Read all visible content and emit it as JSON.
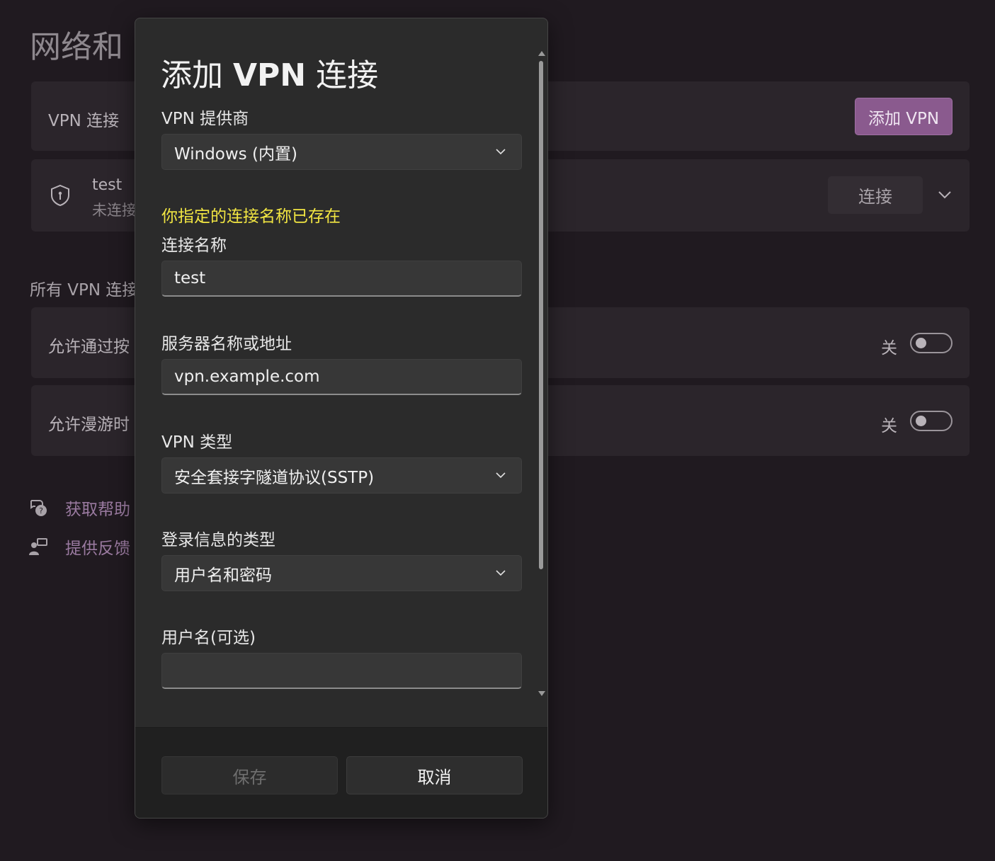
{
  "background": {
    "page_title": "网络和",
    "vpn_card": {
      "label": "VPN 连接",
      "add_button": "添加 VPN"
    },
    "test_card": {
      "name": "test",
      "status": "未连接",
      "connect_button": "连接"
    },
    "section_heading": "所有 VPN 连接",
    "allow_metered": {
      "label": "允许通过按",
      "state": "关"
    },
    "allow_roaming": {
      "label": "允许漫游时",
      "state": "关"
    },
    "links": {
      "help": "获取帮助",
      "feedback": "提供反馈"
    },
    "accent_color": "#8a5a8e"
  },
  "dialog": {
    "title_prefix": "添加 ",
    "title_bold": "VPN",
    "title_suffix": " 连接",
    "provider_label": "VPN 提供商",
    "provider_value": "Windows (内置)",
    "warning": "你指定的连接名称已存在",
    "name_label": "连接名称",
    "name_value": "test",
    "server_label": "服务器名称或地址",
    "server_value": "vpn.example.com",
    "type_label": "VPN 类型",
    "type_value": "安全套接字隧道协议(SSTP)",
    "signin_label": "登录信息的类型",
    "signin_value": "用户名和密码",
    "username_label": "用户名(可选)",
    "username_value": "",
    "save_button": "保存",
    "cancel_button": "取消",
    "warning_color": "#f2e642"
  }
}
